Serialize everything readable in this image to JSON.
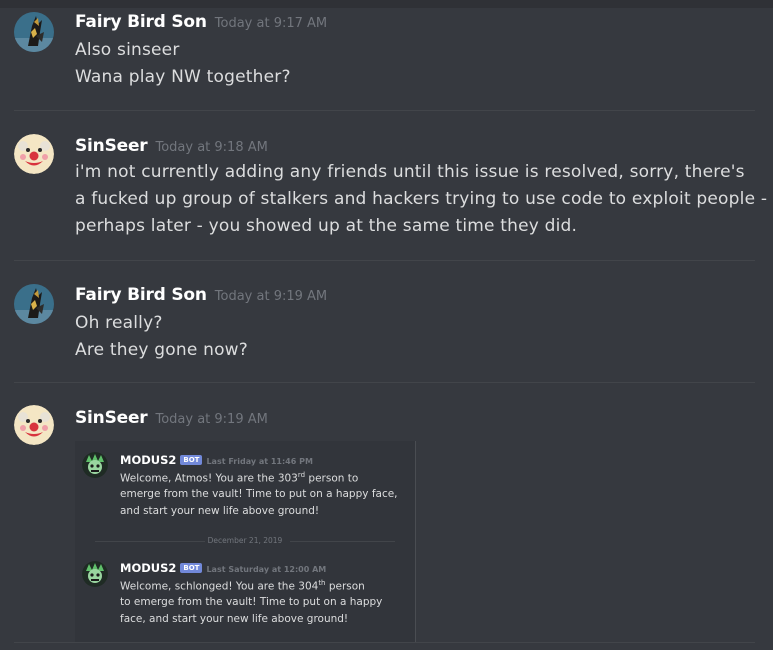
{
  "messages": [
    {
      "author": "Fairy Bird Son",
      "timestamp": "Today at 9:17 AM",
      "avatar": "bird-avatar-icon",
      "lines": [
        "Also sinseer",
        "Wana play NW together?"
      ]
    },
    {
      "author": "SinSeer",
      "timestamp": "Today at 9:18 AM",
      "avatar": "clown-avatar-icon",
      "lines": [
        "i'm not currently adding any friends until this issue is resolved, sorry, there's",
        "a fucked up group of stalkers and hackers trying to use code to exploit people -",
        "perhaps later - you showed up at the same time they did."
      ]
    },
    {
      "author": "Fairy Bird Son",
      "timestamp": "Today at 9:19 AM",
      "avatar": "bird-avatar-icon",
      "lines": [
        "Oh really?",
        "Are they gone now?"
      ]
    },
    {
      "author": "SinSeer",
      "timestamp": "Today at 9:19 AM",
      "avatar": "clown-avatar-icon",
      "lines": []
    }
  ],
  "embed": {
    "date_separator": "December 21, 2019",
    "bot_messages": [
      {
        "author": "MODUS2",
        "badge": "BOT",
        "timestamp": "Last Friday at 11:46 PM",
        "line1_pre": "Welcome, Atmos! You are the 303",
        "line1_sup": "rd",
        "line1_post": " person to",
        "line2": "emerge from the vault! Time to put on a happy face,",
        "line3": "and start your new life above ground!"
      },
      {
        "author": "MODUS2",
        "badge": "BOT",
        "timestamp": "Last Saturday at 12:00 AM",
        "line1_pre": "Welcome, schlonged! You are the 304",
        "line1_sup": "th",
        "line1_post": " person",
        "line2": "to emerge from the vault! Time to put on a happy",
        "line3": "face, and start your new life above ground!"
      }
    ]
  },
  "colors": {
    "background": "#36393f",
    "author": "#ffffff",
    "text": "#dcddde",
    "timestamp": "#72767d",
    "bot_badge": "#7289da"
  }
}
